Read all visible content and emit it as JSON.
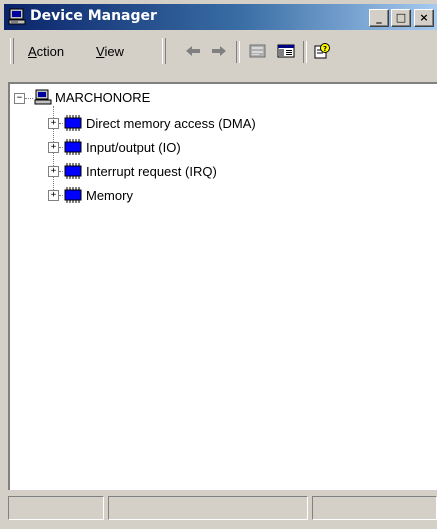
{
  "window": {
    "title": "Device Manager",
    "controls": {
      "minimize": "_",
      "maximize": "□",
      "close": "×"
    }
  },
  "menu": {
    "action": {
      "accel": "A",
      "rest": "ction"
    },
    "view": {
      "accel": "V",
      "rest": "iew"
    }
  },
  "toolbar": {
    "icons": [
      "back-arrow-icon",
      "forward-arrow-icon",
      "properties-icon",
      "show-hide-console-tree-icon",
      "help-icon"
    ]
  },
  "tree": {
    "root": {
      "label": "MARCHONORE",
      "expander": "−",
      "icon": "computer-icon"
    },
    "children": [
      {
        "label": "Direct memory access (DMA)",
        "expander": "+",
        "icon": "chip-icon"
      },
      {
        "label": "Input/output (IO)",
        "expander": "+",
        "icon": "chip-icon"
      },
      {
        "label": "Interrupt request (IRQ)",
        "expander": "+",
        "icon": "chip-icon"
      },
      {
        "label": "Memory",
        "expander": "+",
        "icon": "chip-icon"
      }
    ]
  },
  "status": {
    "cells": [
      "",
      "",
      ""
    ]
  },
  "colors": {
    "title_gradient_start": "#0a246a",
    "title_gradient_end": "#a6caf0",
    "chip_blue": "#0000ff",
    "face": "#d4d0c8"
  }
}
